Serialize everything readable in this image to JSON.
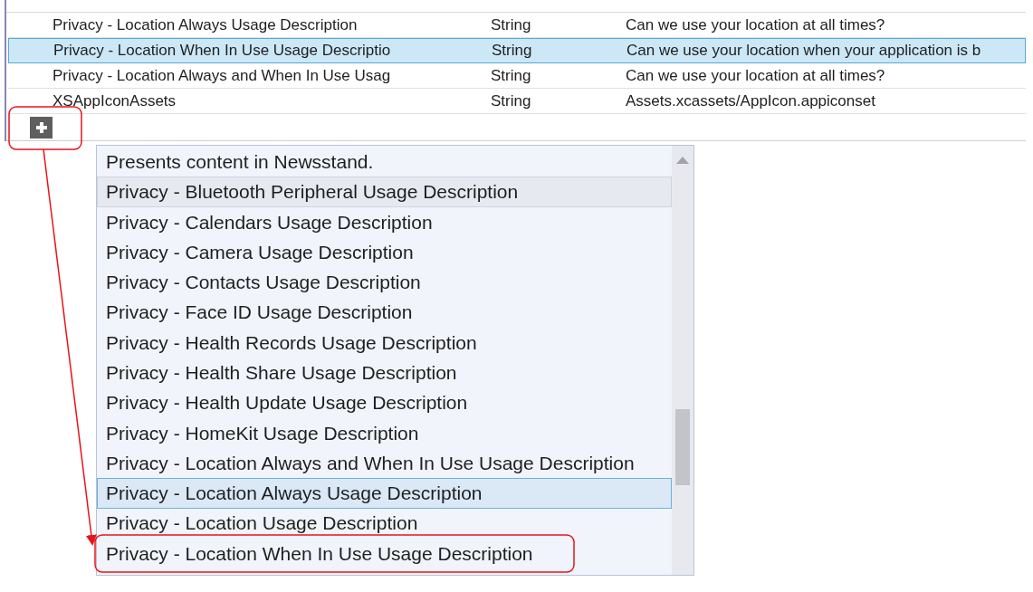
{
  "table": {
    "rows": [
      {
        "key": "Privacy - Location Always Usage Description",
        "type": "String",
        "value": "Can we use your location at all times?",
        "selected": false
      },
      {
        "key": "Privacy - Location When In Use Usage Descriptio",
        "type": "String",
        "value": "Can we use your location when your application is b",
        "selected": true
      },
      {
        "key": "Privacy - Location Always and When In Use Usag",
        "type": "String",
        "value": "Can we use your location at all times?",
        "selected": false
      },
      {
        "key": "XSAppIconAssets",
        "type": "String",
        "value": "Assets.xcassets/AppIcon.appiconset",
        "selected": false
      }
    ]
  },
  "dropdown": {
    "items": [
      {
        "label": "Presents content in Newsstand.",
        "hovered": false,
        "selected": false
      },
      {
        "label": "Privacy - Bluetooth Peripheral Usage Description",
        "hovered": true,
        "selected": false
      },
      {
        "label": "Privacy - Calendars Usage Description",
        "hovered": false,
        "selected": false
      },
      {
        "label": "Privacy - Camera Usage Description",
        "hovered": false,
        "selected": false
      },
      {
        "label": "Privacy - Contacts Usage Description",
        "hovered": false,
        "selected": false
      },
      {
        "label": "Privacy - Face ID Usage Description",
        "hovered": false,
        "selected": false
      },
      {
        "label": "Privacy - Health Records Usage Description",
        "hovered": false,
        "selected": false
      },
      {
        "label": "Privacy - Health Share Usage Description",
        "hovered": false,
        "selected": false
      },
      {
        "label": "Privacy - Health Update Usage Description",
        "hovered": false,
        "selected": false
      },
      {
        "label": "Privacy - HomeKit Usage Description",
        "hovered": false,
        "selected": false
      },
      {
        "label": "Privacy - Location Always and When In Use Usage Description",
        "hovered": false,
        "selected": false
      },
      {
        "label": "Privacy - Location Always Usage Description",
        "hovered": false,
        "selected": true
      },
      {
        "label": "Privacy - Location Usage Description",
        "hovered": false,
        "selected": false
      },
      {
        "label": "Privacy - Location When In Use Usage Description",
        "hovered": false,
        "selected": false
      }
    ]
  }
}
